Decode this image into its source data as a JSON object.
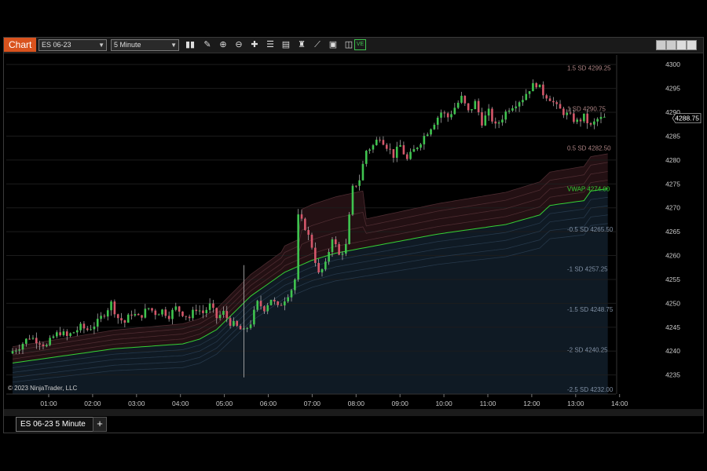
{
  "toolbar": {
    "chart_tab": "Chart",
    "instrument": "ES 06-23",
    "interval": "5 Minute",
    "ve_label": "VE"
  },
  "chart_data": {
    "type": "candlestick",
    "copyright": "© 2023 NinjaTrader, LLC",
    "x_ticks": [
      "01:00",
      "02:00",
      "03:00",
      "04:00",
      "05:00",
      "06:00",
      "07:00",
      "08:00",
      "09:00",
      "10:00",
      "11:00",
      "12:00",
      "13:00",
      "14:00"
    ],
    "y_ticks": [
      4235,
      4240,
      4245,
      4250,
      4255,
      4260,
      4265,
      4270,
      4275,
      4280,
      4285,
      4290,
      4295,
      4300
    ],
    "ylim": [
      4231,
      4302
    ],
    "price_marker": "4288.75",
    "band_labels": [
      {
        "text": "1.5 SD 4299.25",
        "value": 4299.25,
        "color": "#a98080"
      },
      {
        "text": "1 SD 4290.75",
        "value": 4290.75,
        "color": "#a98080"
      },
      {
        "text": "0.5 SD 4282.50",
        "value": 4282.5,
        "color": "#a98080"
      },
      {
        "text": "VWAP 4274.00",
        "value": 4274.0,
        "color": "#35d135"
      },
      {
        "text": "-0.5 SD 4265.50",
        "value": 4265.5,
        "color": "#8090a4"
      },
      {
        "text": "-1 SD 4257.25",
        "value": 4257.25,
        "color": "#8090a4"
      },
      {
        "text": "-1.5 SD 4248.75",
        "value": 4248.75,
        "color": "#8090a4"
      },
      {
        "text": "-2 SD 4240.25",
        "value": 4240.25,
        "color": "#8090a4"
      },
      {
        "text": "-2.5 SD 4232.00",
        "value": 4232.0,
        "color": "#8090a4"
      }
    ],
    "vwap_series": [
      [
        0,
        4237.5
      ],
      [
        10,
        4238.5
      ],
      [
        20,
        4239.5
      ],
      [
        30,
        4240.5
      ],
      [
        40,
        4241
      ],
      [
        50,
        4241.5
      ],
      [
        55,
        4242.5
      ],
      [
        60,
        4244.5
      ],
      [
        65,
        4248
      ],
      [
        70,
        4251.5
      ],
      [
        75,
        4254
      ],
      [
        80,
        4256.5
      ],
      [
        88,
        4259
      ],
      [
        95,
        4260.5
      ],
      [
        110,
        4262.5
      ],
      [
        125,
        4264.5
      ],
      [
        145,
        4266.5
      ],
      [
        155,
        4268.5
      ],
      [
        158,
        4270.5
      ],
      [
        168,
        4271.5
      ],
      [
        170,
        4273.5
      ],
      [
        175,
        4274
      ]
    ],
    "close_series": [
      [
        0,
        4240
      ],
      [
        2,
        4241
      ],
      [
        5,
        4243
      ],
      [
        8,
        4242
      ],
      [
        10,
        4241
      ],
      [
        12,
        4243
      ],
      [
        14,
        4244
      ],
      [
        16,
        4243
      ],
      [
        18,
        4244
      ],
      [
        20,
        4245
      ],
      [
        22,
        4244.5
      ],
      [
        25,
        4246
      ],
      [
        27,
        4248
      ],
      [
        29,
        4250
      ],
      [
        31,
        4247
      ],
      [
        33,
        4246
      ],
      [
        35,
        4248
      ],
      [
        37,
        4247
      ],
      [
        40,
        4249
      ],
      [
        42,
        4248
      ],
      [
        44,
        4248.5
      ],
      [
        46,
        4247.5
      ],
      [
        48,
        4249
      ],
      [
        50,
        4248
      ],
      [
        52,
        4247
      ],
      [
        54,
        4249
      ],
      [
        56,
        4248
      ],
      [
        58,
        4249.5
      ],
      [
        60,
        4247
      ],
      [
        62,
        4248
      ],
      [
        64,
        4246
      ],
      [
        66,
        4245
      ],
      [
        68,
        4244
      ],
      [
        70,
        4246
      ],
      [
        72,
        4250
      ],
      [
        74,
        4249
      ],
      [
        76,
        4251
      ],
      [
        78,
        4249
      ],
      [
        80,
        4251
      ],
      [
        82,
        4253
      ],
      [
        83,
        4255
      ],
      [
        84,
        4268
      ],
      [
        86,
        4266
      ],
      [
        88,
        4262
      ],
      [
        90,
        4256
      ],
      [
        92,
        4258
      ],
      [
        94,
        4264
      ],
      [
        96,
        4260
      ],
      [
        98,
        4262
      ],
      [
        100,
        4274
      ],
      [
        102,
        4276
      ],
      [
        104,
        4282
      ],
      [
        106,
        4283
      ],
      [
        108,
        4285
      ],
      [
        110,
        4283
      ],
      [
        112,
        4281
      ],
      [
        114,
        4283
      ],
      [
        116,
        4280
      ],
      [
        118,
        4282
      ],
      [
        120,
        4284
      ],
      [
        122,
        4286
      ],
      [
        124,
        4288
      ],
      [
        126,
        4290
      ],
      [
        128,
        4289
      ],
      [
        130,
        4291
      ],
      [
        132,
        4293
      ],
      [
        134,
        4290
      ],
      [
        136,
        4292
      ],
      [
        138,
        4288
      ],
      [
        140,
        4290
      ],
      [
        142,
        4287
      ],
      [
        144,
        4289
      ],
      [
        146,
        4291
      ],
      [
        148,
        4292
      ],
      [
        150,
        4293
      ],
      [
        152,
        4295
      ],
      [
        154,
        4296
      ],
      [
        156,
        4294
      ],
      [
        158,
        4293
      ],
      [
        160,
        4291
      ],
      [
        162,
        4290
      ],
      [
        164,
        4289
      ],
      [
        166,
        4288
      ],
      [
        168,
        4289
      ],
      [
        170,
        4287
      ],
      [
        172,
        4288.5
      ],
      [
        174,
        4288.75
      ]
    ],
    "bands_pos": [
      1.8,
      3.6,
      5.5,
      7.3
    ],
    "bands_neg": [
      1.8,
      3.6,
      5.5,
      7.3
    ],
    "colors": {
      "up": "#3fc44f",
      "down": "#d5576a",
      "vwap": "#35d135",
      "upper_fill": "#231013",
      "lower_fill": "#0f1a24",
      "grid": "#1c1c1c",
      "axis_text": "#c8c8c8",
      "chart_tab": "#d9531e"
    }
  },
  "bottom": {
    "tab_label": "ES 06-23 5 Minute",
    "add_label": "+"
  },
  "icons": [
    "bar-chart-icon",
    "pencil-icon",
    "zoom-in-icon",
    "zoom-out-icon",
    "crosshair-icon",
    "properties-icon",
    "indicators-icon",
    "strategies-icon",
    "drawing-tools-icon",
    "screenshot-icon",
    "volumetric-icon"
  ]
}
